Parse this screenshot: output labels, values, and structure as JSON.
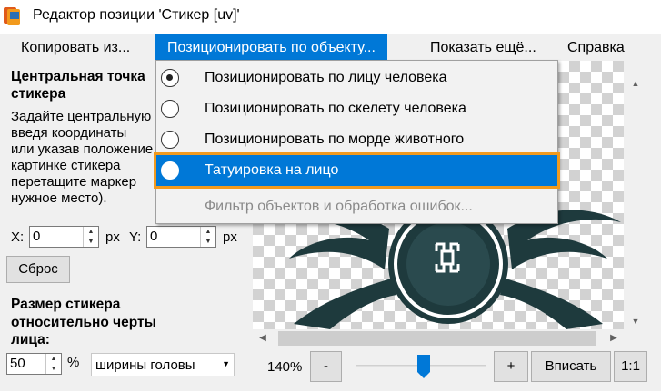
{
  "window": {
    "title": "Редактор позиции 'Стикер [uv]'",
    "icon": "app-sticker-icon"
  },
  "menubar": {
    "items": [
      {
        "label": "Копировать из..."
      },
      {
        "label": "Позиционировать по объекту..."
      },
      {
        "label": "Показать ещё..."
      },
      {
        "label": "Справка"
      }
    ]
  },
  "dropdown": {
    "items": [
      {
        "label": "Позиционировать по лицу человека",
        "state": "checked"
      },
      {
        "label": "Позиционировать по скелету человека",
        "state": "unchecked"
      },
      {
        "label": "Позиционировать по морде животного",
        "state": "unchecked"
      },
      {
        "label": "Татуировка на лицо",
        "state": "highlighted"
      },
      {
        "label": "Фильтр объектов и обработка ошибок...",
        "state": "disabled"
      }
    ]
  },
  "center": {
    "heading_line1": "Центральная точка",
    "heading_line2": "стикера",
    "description": "Задайте центральную\nвведя координаты\nили указав положение\nкартинке стикера\nперетащите маркер\nнужное место).",
    "x_label": "X:",
    "x_value": "0",
    "x_unit": "px",
    "y_label": "Y:",
    "y_value": "0",
    "y_unit": "px",
    "reset_label": "Сброс"
  },
  "size": {
    "heading_line1": "Размер стикера",
    "heading_line2": "относительно черты",
    "heading_line3": "лица:",
    "value": "50",
    "unit": "%",
    "reference_selected": "ширины головы"
  },
  "zoom": {
    "level_label": "140%",
    "level_fraction": 0.5,
    "minus_label": "-",
    "plus_label": "+",
    "fit_label": "Вписать",
    "one_to_one_label": "1:1"
  },
  "colors": {
    "accent": "#0078d7",
    "highlight_outline": "#f29a1d",
    "tattoo": "#1e3a3d"
  }
}
